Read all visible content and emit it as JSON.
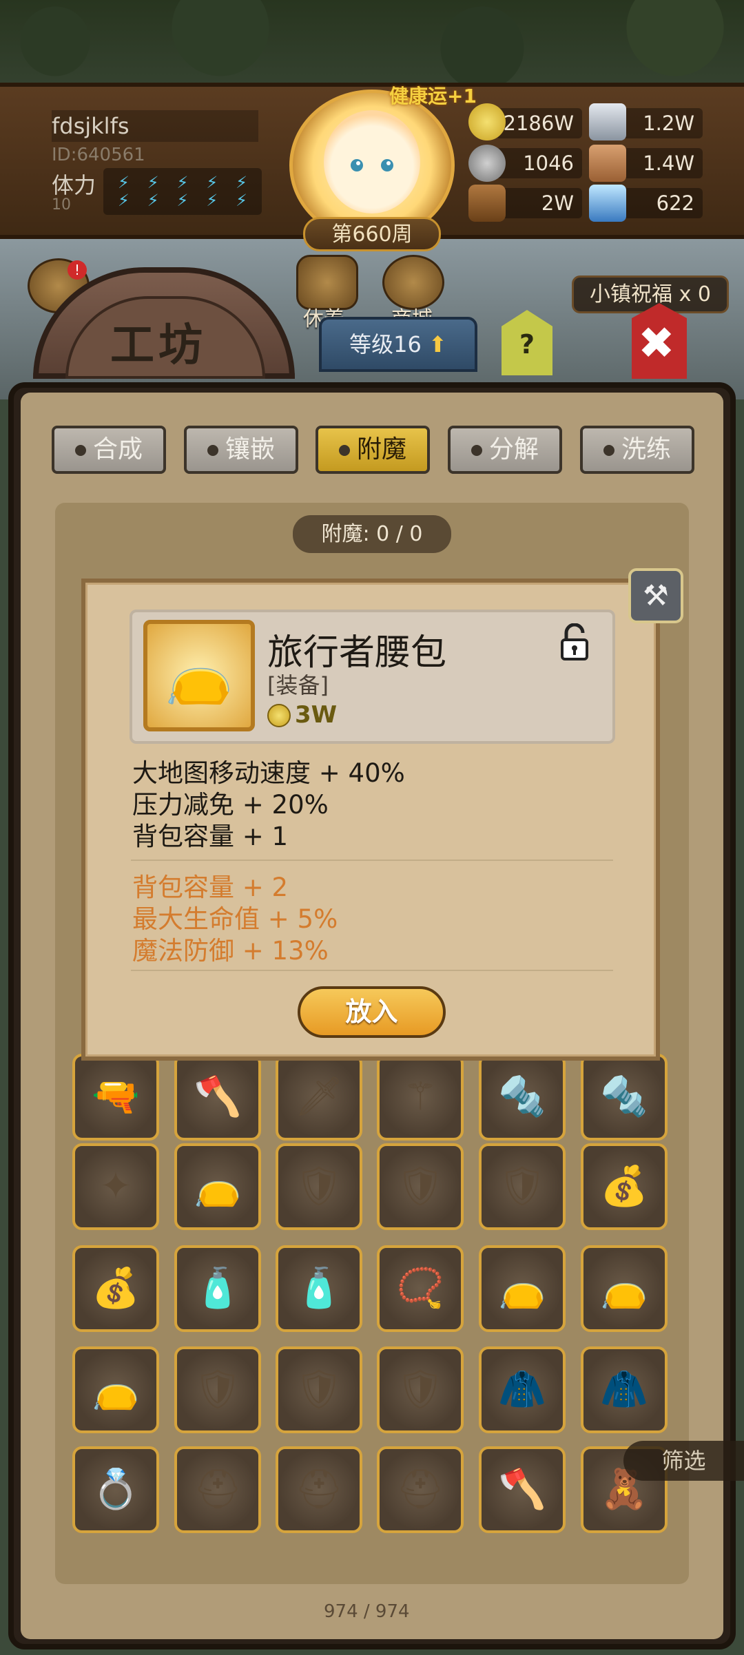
{
  "player": {
    "name": "fdsjklfs",
    "id": "ID:640561",
    "stamina_label": "体力",
    "stamina_value": "10",
    "stamina_bolts": 10
  },
  "header": {
    "lucky_text": "健康运+1",
    "week": "第660周"
  },
  "resources": [
    {
      "icon": "gold-coin-icon",
      "value": "2186W"
    },
    {
      "icon": "iron-ingot-icon",
      "value": "1.2W"
    },
    {
      "icon": "ore-icon",
      "value": "1046"
    },
    {
      "icon": "leather-icon",
      "value": "1.4W"
    },
    {
      "icon": "wood-log-icon",
      "value": "2W"
    },
    {
      "icon": "crystal-icon",
      "value": "622"
    }
  ],
  "nav": {
    "rest": "休养",
    "shop": "商城",
    "blessing": "小镇祝福 x 0"
  },
  "workshop": {
    "title": "工坊",
    "level": "等级16",
    "help": "?"
  },
  "tabs": [
    {
      "label": "合成",
      "active": false
    },
    {
      "label": "镶嵌",
      "active": false
    },
    {
      "label": "附魔",
      "active": true
    },
    {
      "label": "分解",
      "active": false
    },
    {
      "label": "洗练",
      "active": false
    }
  ],
  "enchant_count": "附魔: 0 / 0",
  "popup": {
    "item_name": "旅行者腰包",
    "item_type": "[装备]",
    "price": "3W",
    "base_stats": [
      "大地图移动速度 + 40%",
      "压力减免 + 20%",
      "背包容量 + 1"
    ],
    "bonus_stats": [
      "背包容量 + 2",
      "最大生命值 + 5%",
      "魔法防御 + 13%"
    ],
    "place_button": "放入"
  },
  "inventory": {
    "rows": [
      [
        "gun",
        "axe",
        "sword",
        "staff",
        "drill",
        "drill"
      ],
      [
        "scepter",
        "bag",
        "shield",
        "shield",
        "shield",
        "sack"
      ],
      [
        "sack",
        "bottle",
        "bottle",
        "amulet",
        "bag",
        "bag"
      ],
      [
        "bag",
        "shield",
        "shield",
        "shield",
        "hood",
        "hood"
      ],
      [
        "ring",
        "helmet",
        "helmet",
        "helmet",
        "axe",
        "doll"
      ]
    ],
    "filter": "筛选",
    "count": "974 / 974"
  },
  "colors": {
    "accent_gold": "#e7c34a",
    "bonus_orange": "#d47c2e",
    "panel_bg": "#b19c78"
  }
}
